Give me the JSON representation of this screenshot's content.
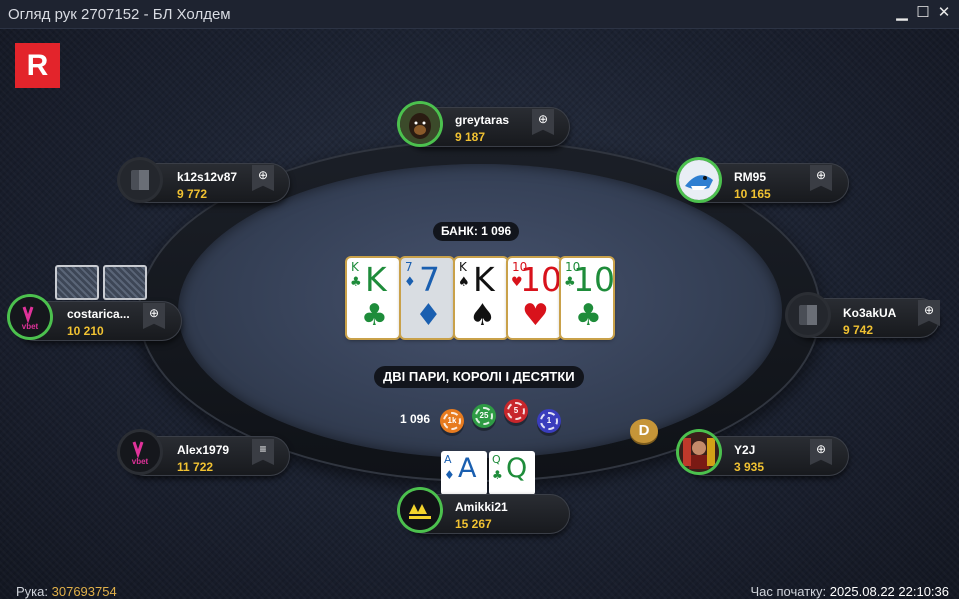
{
  "window": {
    "title": "Огляд рук 2707152 - БЛ Холдем",
    "minimize": "▁",
    "maximize": "☐",
    "close": "✕"
  },
  "brand": {
    "letter": "R",
    "color": "#e3242b"
  },
  "pot": {
    "label": "БАНК: 1 096"
  },
  "board": [
    {
      "rank": "K",
      "suit": "♣",
      "color": "club"
    },
    {
      "rank": "7",
      "suit": "♦",
      "color": "dia"
    },
    {
      "rank": "K",
      "suit": "♠",
      "color": "spade"
    },
    {
      "rank": "10",
      "suit": "♥",
      "color": "heart"
    },
    {
      "rank": "10",
      "suit": "♣",
      "color": "club"
    }
  ],
  "hand_description": "ДВІ ПАРИ, КОРОЛІ І ДЕСЯТКИ",
  "bet": {
    "amount": "1 096",
    "chips": [
      {
        "label": "1k",
        "color": "#e77b1f"
      },
      {
        "label": "25",
        "color": "#2e9b44"
      },
      {
        "label": "5",
        "color": "#c8262b"
      },
      {
        "label": "1",
        "color": "#3a3dbd"
      }
    ]
  },
  "dealer_button": "D",
  "players": [
    {
      "id": "greytaras",
      "name": "greytaras",
      "stack": "9 187",
      "tag": "⊕",
      "avatar": "dog-avatar"
    },
    {
      "id": "k12s12v87",
      "name": "k12s12v87",
      "stack": "9 772",
      "tag": "⊕",
      "avatar": "empty-seat-avatar"
    },
    {
      "id": "RM95",
      "name": "RM95",
      "stack": "10 165",
      "tag": "⊕",
      "avatar": "shark-avatar"
    },
    {
      "id": "costarica",
      "name": "costarica...",
      "stack": "10 210",
      "tag": "⊕",
      "avatar": "vbet-avatar"
    },
    {
      "id": "Ko3akUA",
      "name": "Ko3akUA",
      "stack": "9 742",
      "tag": "⊕",
      "avatar": "empty-seat-avatar"
    },
    {
      "id": "Alex1979",
      "name": "Alex1979",
      "stack": "11 722",
      "tag": "≡",
      "avatar": "vbet-avatar"
    },
    {
      "id": "Y2J",
      "name": "Y2J",
      "stack": "3 935",
      "tag": "⊕",
      "avatar": "wrestler-avatar"
    },
    {
      "id": "Amikki21",
      "name": "Amikki21",
      "stack": "15 267",
      "tag": "",
      "avatar": "navi-avatar"
    }
  ],
  "hero_cards": [
    {
      "rank": "A",
      "suit": "♦",
      "color": "dia"
    },
    {
      "rank": "Q",
      "suit": "♣",
      "color": "club"
    }
  ],
  "status": {
    "hand_label": "Рука:",
    "hand_number": "307693754",
    "start_label": "Час початку:",
    "start_time": "2025.08.22 22:10:36"
  }
}
